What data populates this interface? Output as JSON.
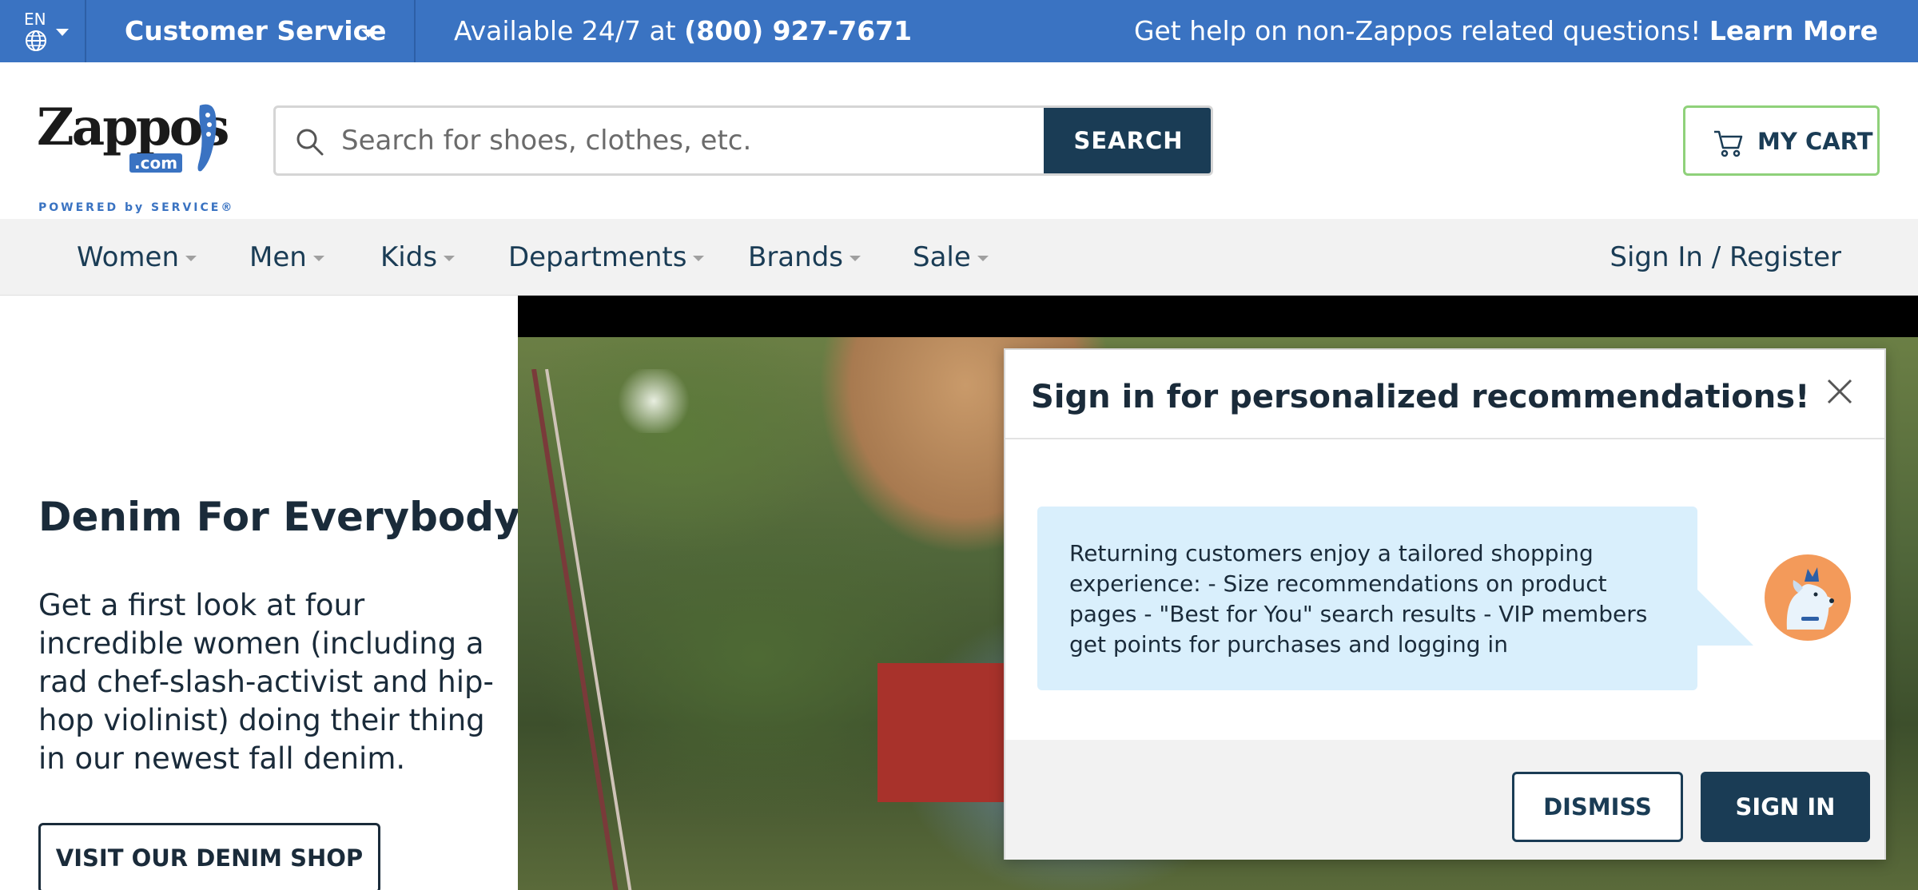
{
  "topbar": {
    "language": "EN",
    "customer_service": "Customer Service",
    "available_prefix": "Available 24/7 at ",
    "phone": "(800) 927-7671",
    "help_text": "Get help on non-Zappos related questions! ",
    "learn_more": "Learn More",
    "background_color": "#3a73c2"
  },
  "header": {
    "logo": {
      "wordmark": "Zappos",
      "dotcom": ".com",
      "tagline": "POWERED by SERVICE®"
    },
    "search": {
      "placeholder": "Search for shoes, clothes, etc.",
      "value": "",
      "button_label": "SEARCH"
    },
    "cart_label": "MY CART"
  },
  "nav": {
    "items": [
      {
        "label": "Women"
      },
      {
        "label": "Men"
      },
      {
        "label": "Kids"
      },
      {
        "label": "Departments"
      },
      {
        "label": "Brands"
      },
      {
        "label": "Sale"
      }
    ],
    "signin_label": "Sign In / Register"
  },
  "promo": {
    "title": "Denim For Everybody",
    "body": "Get a first look at four incredible women (including a rad chef-slash-activist and hip-hop violinist) doing their thing in our newest fall denim.",
    "button_label": "VISIT OUR DENIM SHOP"
  },
  "modal": {
    "title": "Sign in for personalized recommendations!",
    "message": "Returning customers enjoy a tailored shopping experience: - Size recommendations on product pages - \"Best for You\" search results - VIP members get points for purchases and logging in",
    "dismiss_label": "DISMISS",
    "signin_label": "SIGN IN"
  },
  "colors": {
    "brand_blue": "#3a73c2",
    "navy": "#1a3c55",
    "cart_border": "#8fd17a",
    "bubble": "#d9effc",
    "mascot_orange": "#f39a5a"
  }
}
